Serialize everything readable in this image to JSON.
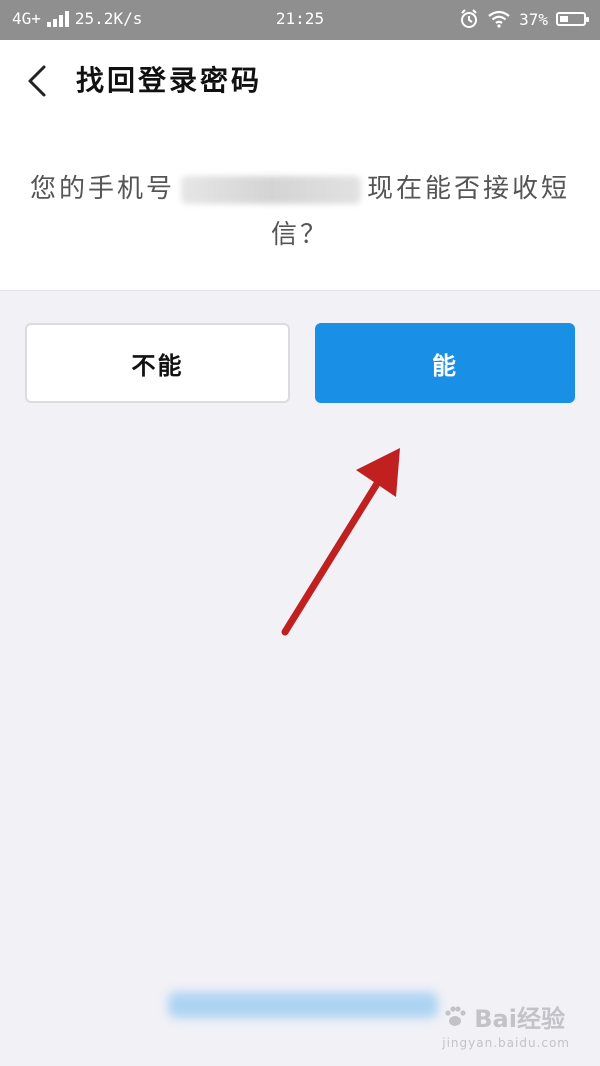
{
  "status_bar": {
    "network": "4G+",
    "speed": "25.2K/s",
    "time": "21:25",
    "battery": "37%",
    "battery_level": 0.37
  },
  "header": {
    "title": "找回登录密码"
  },
  "question": {
    "prefix": "您的手机号",
    "suffix": "现在能否接收短信？"
  },
  "buttons": {
    "no_label": "不能",
    "yes_label": "能"
  },
  "colors": {
    "accent": "#1a8fe6",
    "annotation_arrow": "#c0201f"
  },
  "watermark": {
    "brand": "Bai经验",
    "url": "jingyan.baidu.com"
  }
}
